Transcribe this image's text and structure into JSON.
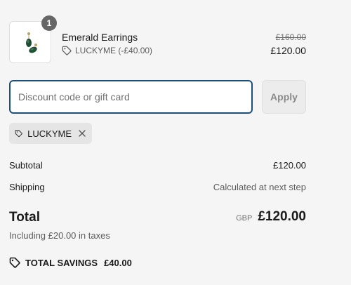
{
  "product": {
    "name": "Emerald Earrings",
    "quantity": "1",
    "discount_label": "LUCKYME (-£40.00)",
    "original_price": "£160.00",
    "price": "£120.00",
    "image_icon": "emerald-earrings-thumbnail"
  },
  "discount": {
    "placeholder": "Discount code or gift card",
    "value": "",
    "apply_label": "Apply",
    "applied_code": "LUCKYME",
    "tag_icon": "tag-icon",
    "remove_icon": "close-icon"
  },
  "summary": {
    "subtotal_label": "Subtotal",
    "subtotal_value": "£120.00",
    "shipping_label": "Shipping",
    "shipping_value": "Calculated at next step",
    "total_label": "Total",
    "currency": "GBP",
    "total_value": "£120.00",
    "taxes_note": "Including £20.00 in taxes",
    "savings_label": "TOTAL SAVINGS",
    "savings_value": "£40.00"
  },
  "colors": {
    "background": "#f5f5f5",
    "input_border": "#1f4e79",
    "badge": "#666666",
    "muted_text": "#5c5c5c"
  }
}
